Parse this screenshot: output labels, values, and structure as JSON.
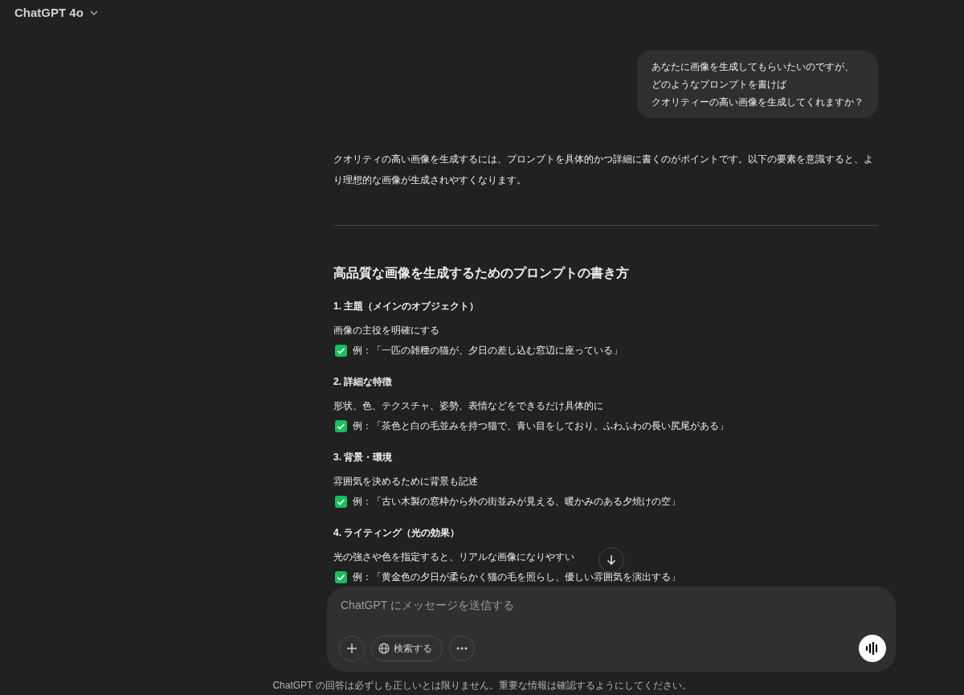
{
  "header": {
    "model": "ChatGPT 4o"
  },
  "user_message": {
    "lines": [
      "あなたに画像を生成してもらいたいのですが、",
      "どのようなプロンプトを書けば",
      "クオリティーの高い画像を生成してくれますか？"
    ]
  },
  "response": {
    "intro": "クオリティの高い画像を生成するには、プロンプトを具体的かつ詳細に書くのがポイントです。以下の要素を意識すると、より理想的な画像が生成されやすくなります。",
    "heading": "高品質な画像を生成するためのプロンプトの書き方",
    "sections": [
      {
        "title": "1. 主題（メインのオブジェクト）",
        "description": "画像の主役を明確にする",
        "example": "例：「一匹の雑種の猫が、夕日の差し込む窓辺に座っている」"
      },
      {
        "title": "2. 詳細な特徴",
        "description": "形状、色、テクスチャ、姿勢、表情などをできるだけ具体的に",
        "example": "例：「茶色と白の毛並みを持つ猫で、青い目をしており、ふわふわの長い尻尾がある」"
      },
      {
        "title": "3. 背景・環境",
        "description": "雰囲気を決めるために背景も記述",
        "example": "例：「古い木製の窓枠から外の街並みが見える、暖かみのある夕焼けの空」"
      },
      {
        "title": "4. ライティング（光の効果）",
        "description": "光の強さや色を指定すると、リアルな画像になりやすい",
        "example": "例：「黄金色の夕日が柔らかく猫の毛を照らし、優しい雰囲気を演出する」"
      }
    ]
  },
  "composer": {
    "placeholder": "ChatGPT にメッセージを送信する",
    "tools": [
      {
        "kind": "plus"
      },
      {
        "kind": "search",
        "label": "検索する"
      },
      {
        "kind": "more"
      }
    ]
  },
  "disclaimer": "ChatGPT の回答は必ずしも正しいとは限りません。重要な情報は確認するようにしてください。"
}
